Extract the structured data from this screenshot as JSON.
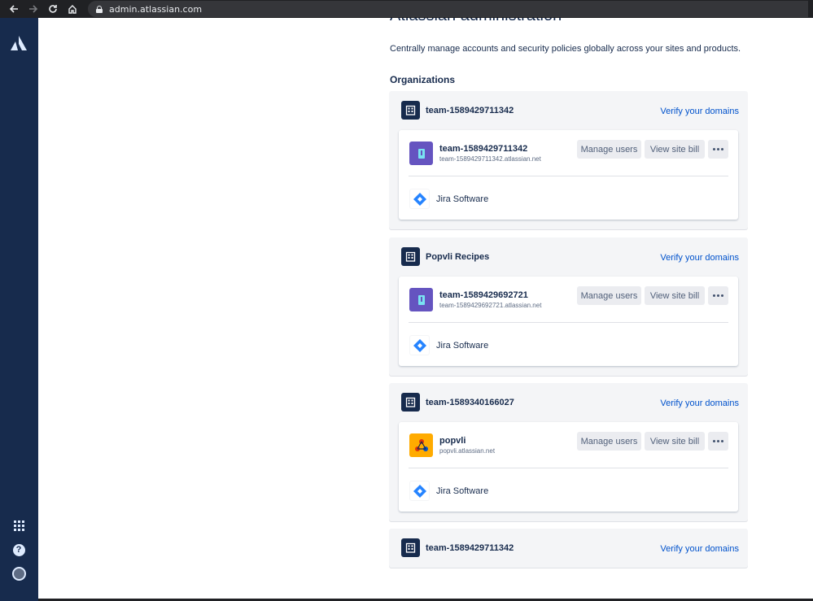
{
  "browser": {
    "url": "admin.atlassian.com",
    "icons": [
      "back-arrow-icon",
      "forward-arrow-icon",
      "reload-icon",
      "home-icon",
      "lock-icon"
    ]
  },
  "leftnav": {
    "icons": [
      "atlassian-logo",
      "app-switcher-icon",
      "help-icon",
      "user-avatar"
    ],
    "help_glyph": "?"
  },
  "page": {
    "title": "Atlassian administration",
    "subtitle": "Centrally manage accounts and security policies globally across your sites and products.",
    "organizations_heading": "Organizations"
  },
  "organizations": [
    {
      "name": "team-1589429711342",
      "verify_label": "Verify your domains",
      "site": {
        "name": "team-1589429711342",
        "url": "team-1589429711342.atlassian.net",
        "avatar": "purple-site-icon",
        "manage_label": "Manage users",
        "bill_label": "View site bill",
        "product": "Jira Software"
      }
    },
    {
      "name": "Popvli Recipes",
      "verify_label": "Verify your domains",
      "site": {
        "name": "team-1589429692721",
        "url": "team-1589429692721.atlassian.net",
        "avatar": "purple-site-icon",
        "manage_label": "Manage users",
        "bill_label": "View site bill",
        "product": "Jira Software"
      }
    },
    {
      "name": "team-1589340166027",
      "verify_label": "Verify your domains",
      "site": {
        "name": "popvli",
        "url": "popvli.atlassian.net",
        "avatar": "orange-site-icon",
        "manage_label": "Manage users",
        "bill_label": "View site bill",
        "product": "Jira Software"
      }
    },
    {
      "name": "team-1589429711342",
      "verify_label": "Verify your domains"
    }
  ],
  "colors": {
    "nav_bg": "#172b4d",
    "link": "#0052cc",
    "jira_blue": "#2684ff",
    "purple_site": "#6554c0",
    "orange_site": "#ffab00"
  }
}
